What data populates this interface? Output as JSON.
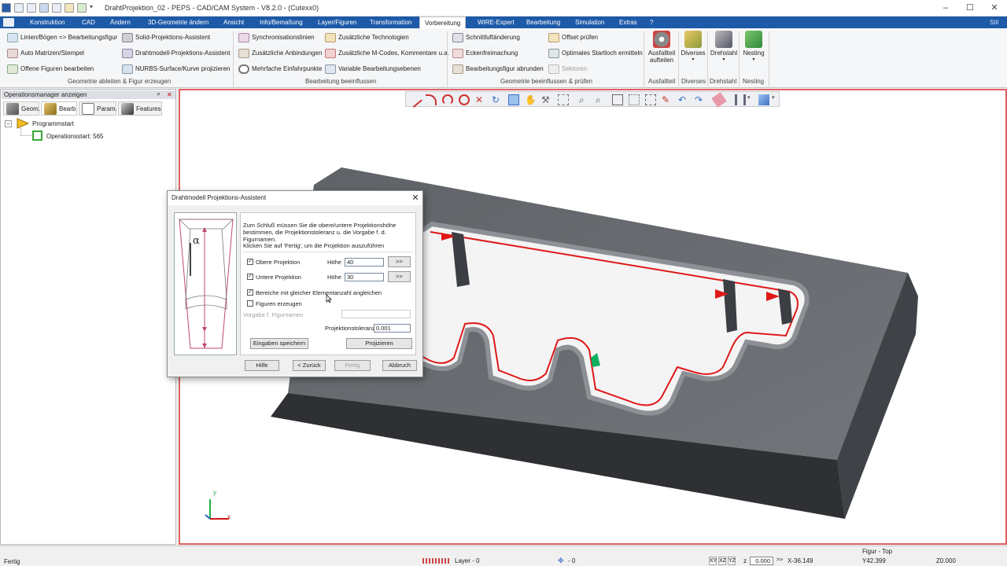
{
  "window": {
    "title": "DrahtProjektion_02 - PEPS - CAD/CAM System - V8.2.0 - (Cutexx0)",
    "controls": [
      "–",
      "☐",
      "✕"
    ]
  },
  "menu": {
    "items": [
      "Konstruktion",
      "CAD",
      "Ändern",
      "3D-Geometrie ändern",
      "Ansicht",
      "Info/Bemaßung",
      "Layer/Figuren",
      "Transformation",
      "Vorbereitung",
      "WIRE-Expert",
      "Bearbeitung",
      "Simulation",
      "Extras",
      "?"
    ],
    "active": "Vorbereitung",
    "right_label": "Stil"
  },
  "ribbon": {
    "group1": {
      "items": [
        "Linien/Bögen => Bearbeitungsfigur",
        "Auto Matrizen/Stempel",
        "Offene Figuren bearbeiten",
        "Solid-Projektions-Assistent",
        "Drahtmodell-Projektions-Assistent",
        "NURBS-Surface/Kurve projizieren"
      ],
      "label": "Geometrie ableiten & Figur erzeugen"
    },
    "group2": {
      "items": [
        "Synchronisationslinien",
        "Zusätzliche Anbindungen",
        "Mehrfache Einfahrpunkte",
        "Zusätzliche Technologien",
        "Zusätzliche M-Codes, Kommentare u.a.",
        "Variable Bearbeitungsebenen"
      ],
      "label": "Bearbeitung beeinflussen"
    },
    "group3": {
      "items": [
        "Schnittluftänderung",
        "Eckenfreimachung",
        "Bearbeitungsfigur abrunden",
        "Offset prüfen",
        "Optimales Startloch ermitteln",
        "Sektoren"
      ],
      "label": "Geometrie beeinflussen & prüfen"
    },
    "big_buttons": [
      {
        "label": "Ausfallteil aufteilen",
        "group": "Ausfallteil"
      },
      {
        "label": "Diverses",
        "group": "Diverses"
      },
      {
        "label": "Drehstahl",
        "group": "Drehstahl"
      },
      {
        "label": "Nesting",
        "group": "Nesting"
      }
    ]
  },
  "left_panel": {
    "title": "Operationsmanager anzeigen",
    "pin": "ᵖ",
    "close": "✕",
    "tabs": [
      "Geom.",
      "Bearb",
      "Param.",
      "Features"
    ],
    "tree": [
      "Programmstart",
      "Operationsstart: 565"
    ]
  },
  "dialog": {
    "title": "Drahtmodell Projektions-Assistent",
    "close": "✕",
    "intro": "Zum Schluß müssen Sie die obere/untere Projektionshöhe bestimmen, die Projektionstoleranz u. die Vorgabe f. d. Figurnamen.",
    "hint": "Klicken Sie auf 'Fertig', um die Projektion auszuführen",
    "check_obere": "Obere Projektion",
    "check_untere": "Untere Projektion",
    "hoehe_label": "Höhe",
    "obere_value": "40",
    "untere_value": "30",
    "more_btn": ">>",
    "check_bereiche": "Bereiche mit gleicher Elementanzahl angleichen",
    "check_figuren": "Figuren erzeugen",
    "vorgabe_label": "Vorgabe f. Figurnamen",
    "vorgabe_value": "",
    "toleranz_label": "Projektionstoleranz",
    "toleranz_value": "0.001",
    "save_btn": "Eingaben speichern",
    "project_btn": "Projizieren",
    "help_btn": "Hilfe",
    "back_btn": "< Zurück",
    "finish_btn": "Fertig",
    "cancel_btn": "Abbruch",
    "img_symbol": "α"
  },
  "status": {
    "left": "Fertig",
    "figur": "Figur - Top",
    "layer": "Layer - 0",
    "layer2": "- 0",
    "axis_btns": [
      "XY",
      "XZ",
      "YZ"
    ],
    "z_label": "z",
    "z_value": "0.000",
    "x_value": "X-36.149",
    "y_value": "Y42.399",
    "z_coord": "Z0.000",
    "arrows": ">>"
  },
  "colors": {
    "menu_bg": "#1d5aa8",
    "accent_red": "#e02020",
    "part_gray": "#6b6e72"
  },
  "axis": {
    "x": "x",
    "y": "y"
  }
}
